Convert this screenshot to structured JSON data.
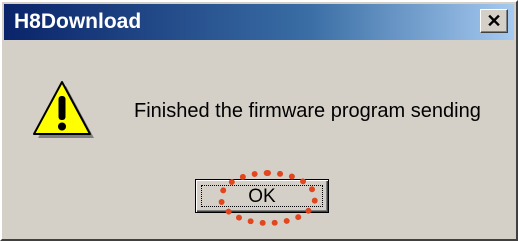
{
  "window": {
    "title": "H8Download",
    "close_glyph": "✕"
  },
  "dialog": {
    "icon": "warning-icon",
    "message": "Finished the firmware program sending"
  },
  "buttons": {
    "ok_label": "OK"
  },
  "annotation": {
    "highlight": "ok-button",
    "color": "#e2461f"
  }
}
